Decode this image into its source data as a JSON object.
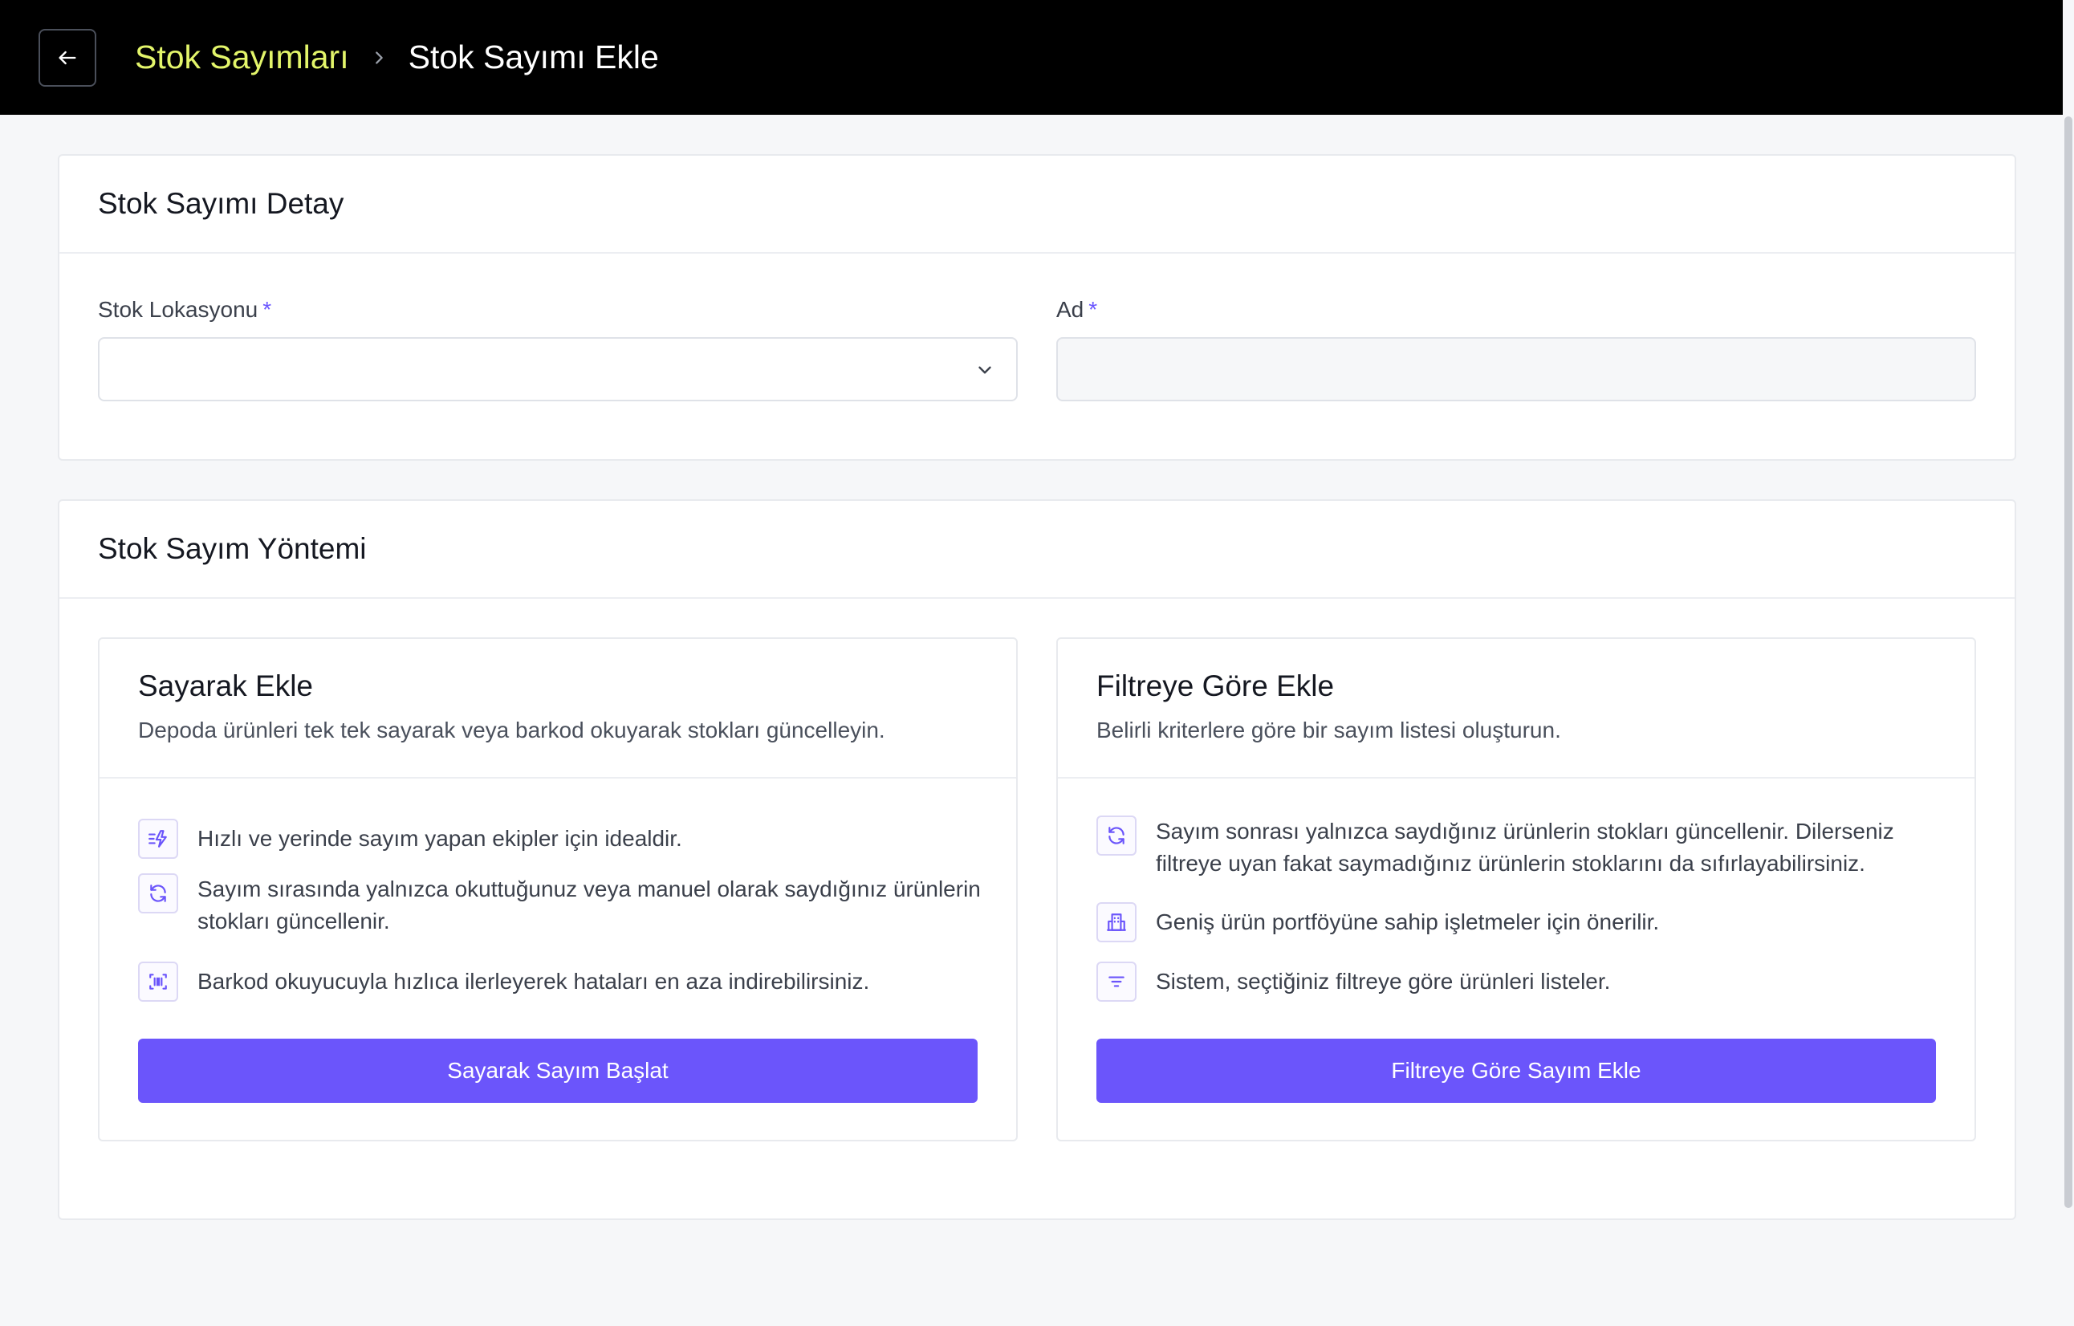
{
  "breadcrumb": {
    "parent": "Stok Sayımları",
    "current": "Stok Sayımı Ekle"
  },
  "detail_card": {
    "title": "Stok Sayımı Detay",
    "location_label": "Stok Lokasyonu",
    "location_value": "",
    "name_label": "Ad",
    "name_value": "",
    "required_mark": "*"
  },
  "method_card": {
    "title": "Stok Sayım Yöntemi",
    "options": [
      {
        "title": "Sayarak Ekle",
        "description": "Depoda ürünleri tek tek sayarak veya barkod okuyarak stokları güncelleyin.",
        "features": [
          {
            "icon": "fast-icon",
            "text": "Hızlı ve yerinde sayım yapan ekipler için idealdir."
          },
          {
            "icon": "refresh-icon",
            "text": "Sayım sırasında yalnızca okuttuğunuz veya manuel olarak saydığınız ürünlerin stokları güncellenir."
          },
          {
            "icon": "barcode-scan-icon",
            "text": "Barkod okuyucuyla hızlıca ilerleyerek hataları en aza indirebilirsiniz."
          }
        ],
        "button": "Sayarak Sayım Başlat"
      },
      {
        "title": "Filtreye Göre Ekle",
        "description": "Belirli kriterlere göre bir sayım listesi oluşturun.",
        "features": [
          {
            "icon": "refresh-icon",
            "text": "Sayım sonrası yalnızca saydığınız ürünlerin stokları güncellenir. Dilerseniz filtreye uyan fakat saymadığınız ürünlerin stoklarını da sıfırlayabilirsiniz."
          },
          {
            "icon": "building-icon",
            "text": "Geniş ürün portföyüne sahip işletmeler için önerilir."
          },
          {
            "icon": "filter-icon",
            "text": "Sistem, seçtiğiniz filtreye göre ürünleri listeler."
          }
        ],
        "button": "Filtreye Göre Sayım Ekle"
      }
    ]
  },
  "colors": {
    "accent": "#6b55fb",
    "breadcrumb_link": "#e3f56a",
    "topbar": "#000000"
  }
}
